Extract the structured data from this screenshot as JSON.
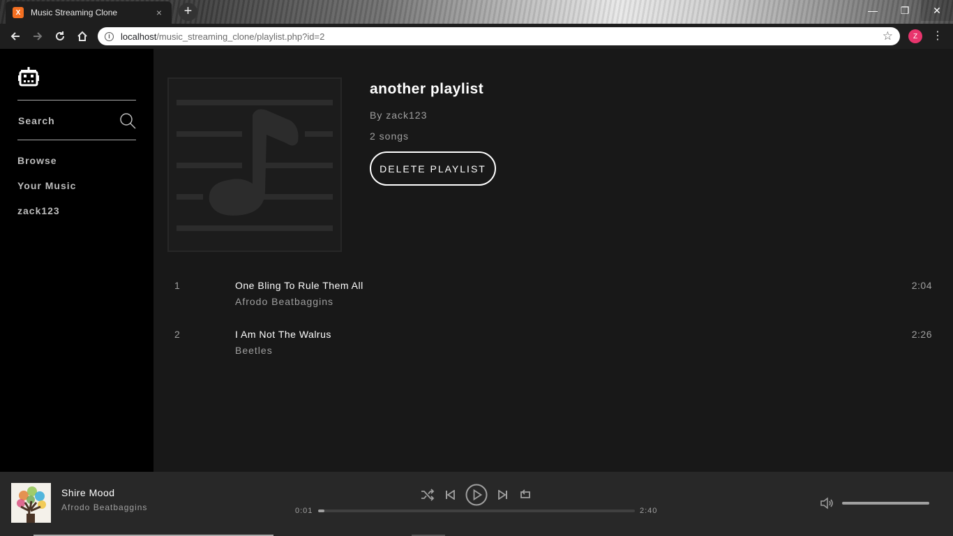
{
  "browser": {
    "tab_title": "Music Streaming Clone",
    "favicon_text": "X",
    "tab_close": "×",
    "new_tab": "+",
    "url_host": "localhost",
    "url_path": "/music_streaming_clone/playlist.php?id=2",
    "profile_initial": "Z",
    "window_controls": {
      "minimize": "—",
      "restore": "❐",
      "close": "✕"
    }
  },
  "sidebar": {
    "search_label": "Search",
    "nav": [
      {
        "label": "Browse"
      },
      {
        "label": "Your Music"
      },
      {
        "label": "zack123"
      }
    ]
  },
  "playlist": {
    "title": "another playlist",
    "owner": "By zack123",
    "song_count": "2 songs",
    "delete_label": "DELETE PLAYLIST",
    "tracks": [
      {
        "number": "1",
        "name": "One Bling To Rule Them All",
        "artist": "Afrodo Beatbaggins",
        "duration": "2:04"
      },
      {
        "number": "2",
        "name": "I Am Not The Walrus",
        "artist": "Beetles",
        "duration": "2:26"
      }
    ]
  },
  "player": {
    "now_title": "Shire Mood",
    "now_artist": "Afrodo Beatbaggins",
    "current_time": "0:01",
    "total_time": "2:40",
    "progress_fraction": 0.005,
    "volume_fraction": 1.0,
    "icons": [
      "shuffle-icon",
      "previous-icon",
      "play-icon",
      "next-icon",
      "repeat-icon",
      "volume-icon"
    ]
  },
  "colors": {
    "main_bg": "#181818",
    "sidebar_bg": "#000000",
    "player_bg": "#282828",
    "muted_text": "#a0a0a0",
    "profile_accent": "#e8356d"
  }
}
